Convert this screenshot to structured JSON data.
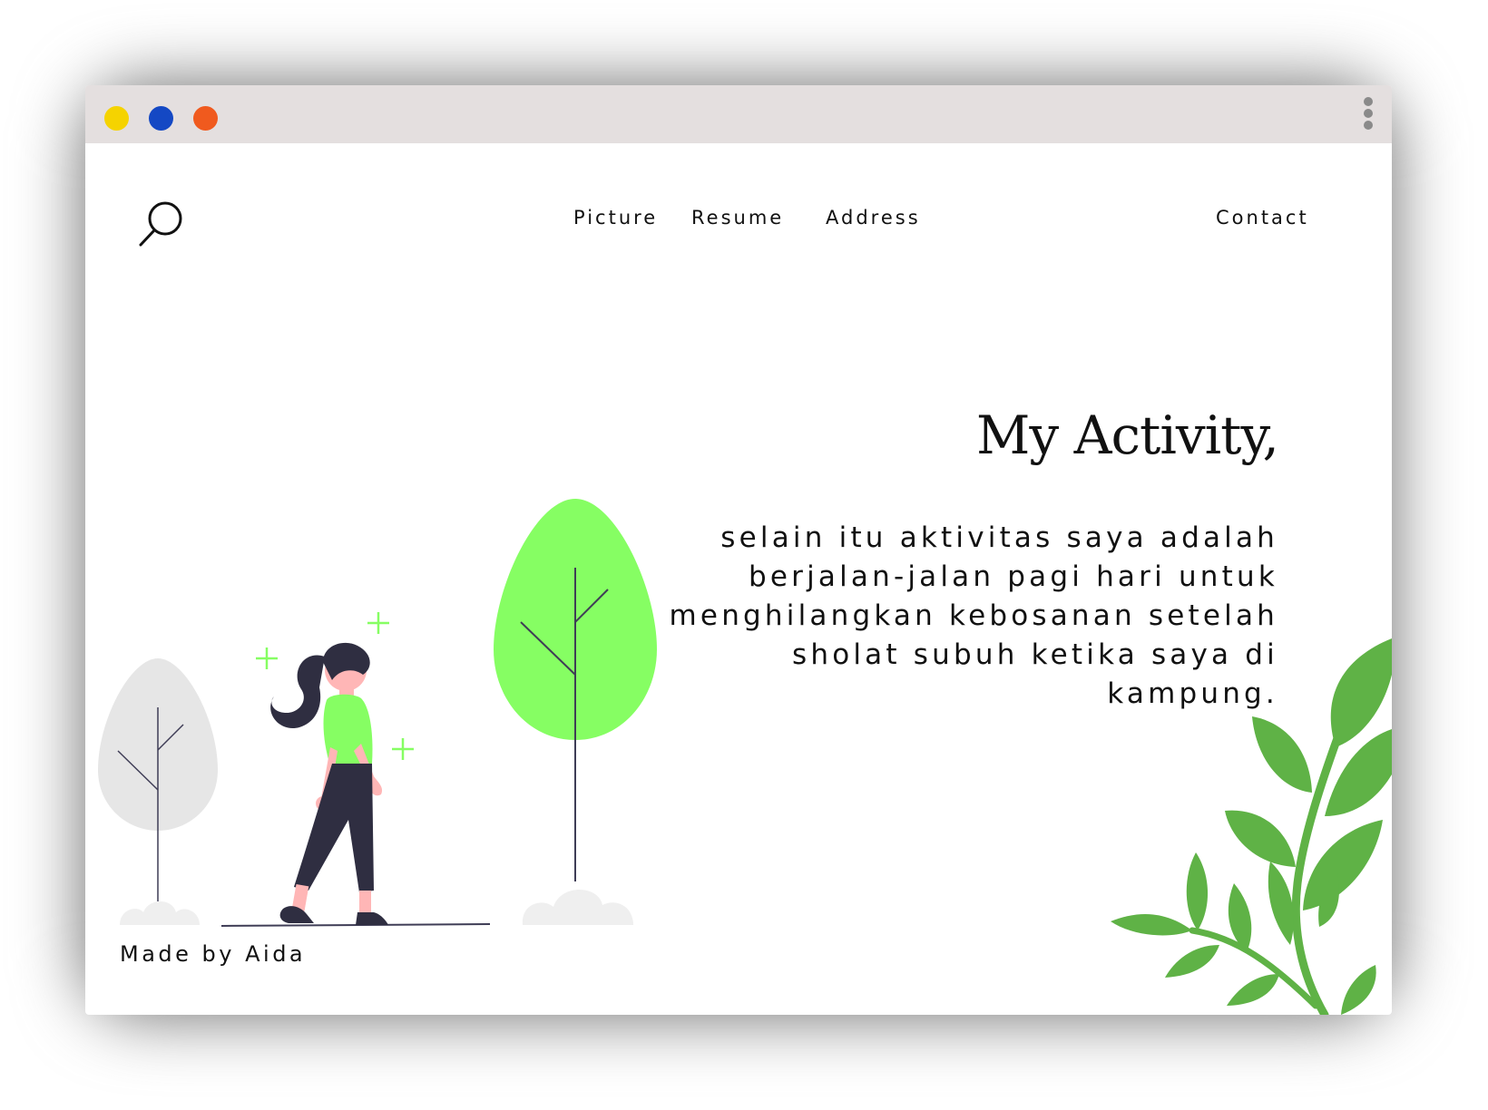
{
  "window": {
    "traffic_lights": [
      {
        "name": "yellow",
        "color": "#f5d300"
      },
      {
        "name": "blue",
        "color": "#1448c4"
      },
      {
        "name": "orange",
        "color": "#f05a1e"
      }
    ],
    "menu_icon": "vertical-ellipsis-icon"
  },
  "header": {
    "search_icon": "search-icon",
    "nav": [
      "Picture",
      "Resume",
      "Address"
    ],
    "contact": "Contact"
  },
  "hero": {
    "title": "My Activity,",
    "body": "selain itu aktivitas saya adalah berjalan-jalan pagi hari untuk menghilangkan kebosanan setelah sholat subuh ketika saya di kampung."
  },
  "footer": {
    "credit": "Made by Aida"
  },
  "colors": {
    "accent_green": "#86fe63",
    "leaf_green": "#5fb246",
    "grey_tree": "#e6e6e6",
    "dark": "#2f2e41",
    "skin": "#ffb6b6"
  }
}
